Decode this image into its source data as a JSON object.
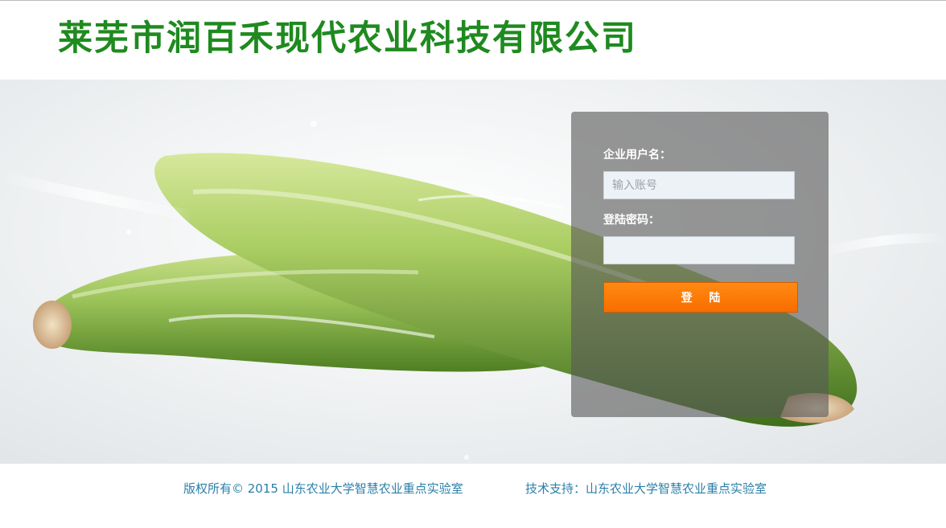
{
  "header": {
    "company_name": "莱芜市润百禾现代农业科技有限公司"
  },
  "login": {
    "username_label": "企业用户名：",
    "username_placeholder": "输入账号",
    "username_value": "",
    "password_label": "登陆密码：",
    "password_value": "",
    "submit_label": "登 陆"
  },
  "footer": {
    "copyright": "版权所有© 2015 山东农业大学智慧农业重点实验室",
    "support": "技术支持：山东农业大学智慧农业重点实验室"
  },
  "colors": {
    "title_green": "#1f8a1f",
    "button_orange": "#ff7a00",
    "footer_blue": "#2a7fa8"
  }
}
